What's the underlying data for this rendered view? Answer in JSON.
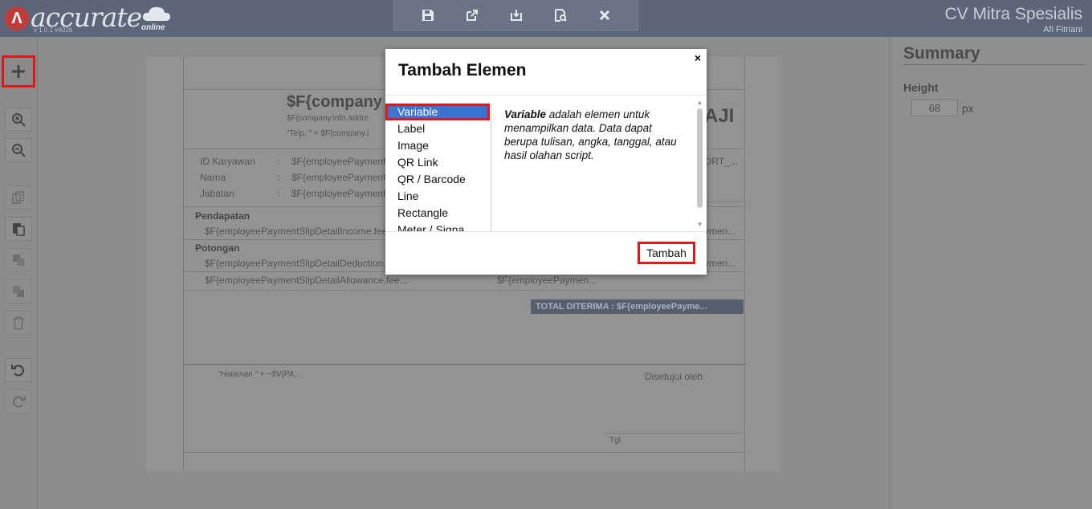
{
  "app": {
    "logo_text": "accurate",
    "logo_sub": "online",
    "version": "v 1.0.1 #4026",
    "company_name": "CV Mitra Spesialis",
    "user_name": "Afi Fitriani"
  },
  "toolbar": {
    "items": [
      "save-icon",
      "export-icon",
      "import-icon",
      "preview-icon",
      "close-icon"
    ]
  },
  "sidebar": {
    "items": [
      "add-icon",
      "zoom-in-icon",
      "zoom-out-icon",
      "copy-icon",
      "paste-icon",
      "bring-front-icon",
      "send-back-icon",
      "delete-icon",
      "undo-icon",
      "redo-icon"
    ]
  },
  "report": {
    "company_title": "$F{company",
    "company_address": "$F{company.info.addre",
    "company_phone": "\"Telp. \" + $F{company.i",
    "doc_title_fragment": "AJI",
    "sort_fragment": "ORT_...",
    "fields": [
      {
        "label": "ID Karyawan",
        "value": "$F{employeePayment"
      },
      {
        "label": "Nama",
        "value": "$F{employeePayment"
      },
      {
        "label": "Jabatan",
        "value": "$F{employeePayment"
      }
    ],
    "pendapatan_label": "Pendapatan",
    "income_row": "$F{employeePaymentSlipDetailIncome.fee",
    "income_amount": "ymen...",
    "potongan_label": "Potongan",
    "deduction_row": "$F{employeePaymentSlipDetailDeduction.",
    "deduction_amount": "ymen...",
    "allowance_row": "$F{employeePaymentSlipDetailAllowance.fee...",
    "allowance_amount": "$F{employeePaymen...",
    "total_label": "TOTAL DITERIMA : $F{employeePayme...",
    "page_footer": "\"Halaman \" + ~$V{PA...",
    "approved_label": "Disetujui oleh",
    "date_label": "Tgl."
  },
  "summary": {
    "title": "Summary",
    "height_label": "Height",
    "height_value": "68",
    "height_unit": "px"
  },
  "modal": {
    "title": "Tambah Elemen",
    "close_label": "×",
    "items": [
      "Variable",
      "Label",
      "Image",
      "QR Link",
      "QR / Barcode",
      "Line",
      "Rectangle",
      "Meter / Signa"
    ],
    "selected_index": 0,
    "description_bold": "Variable",
    "description_rest": " adalah elemen untuk menampilkan data. Data dapat berupa tulisan, angka, tanggal, atau hasil olahan script.",
    "submit_label": "Tambah"
  }
}
